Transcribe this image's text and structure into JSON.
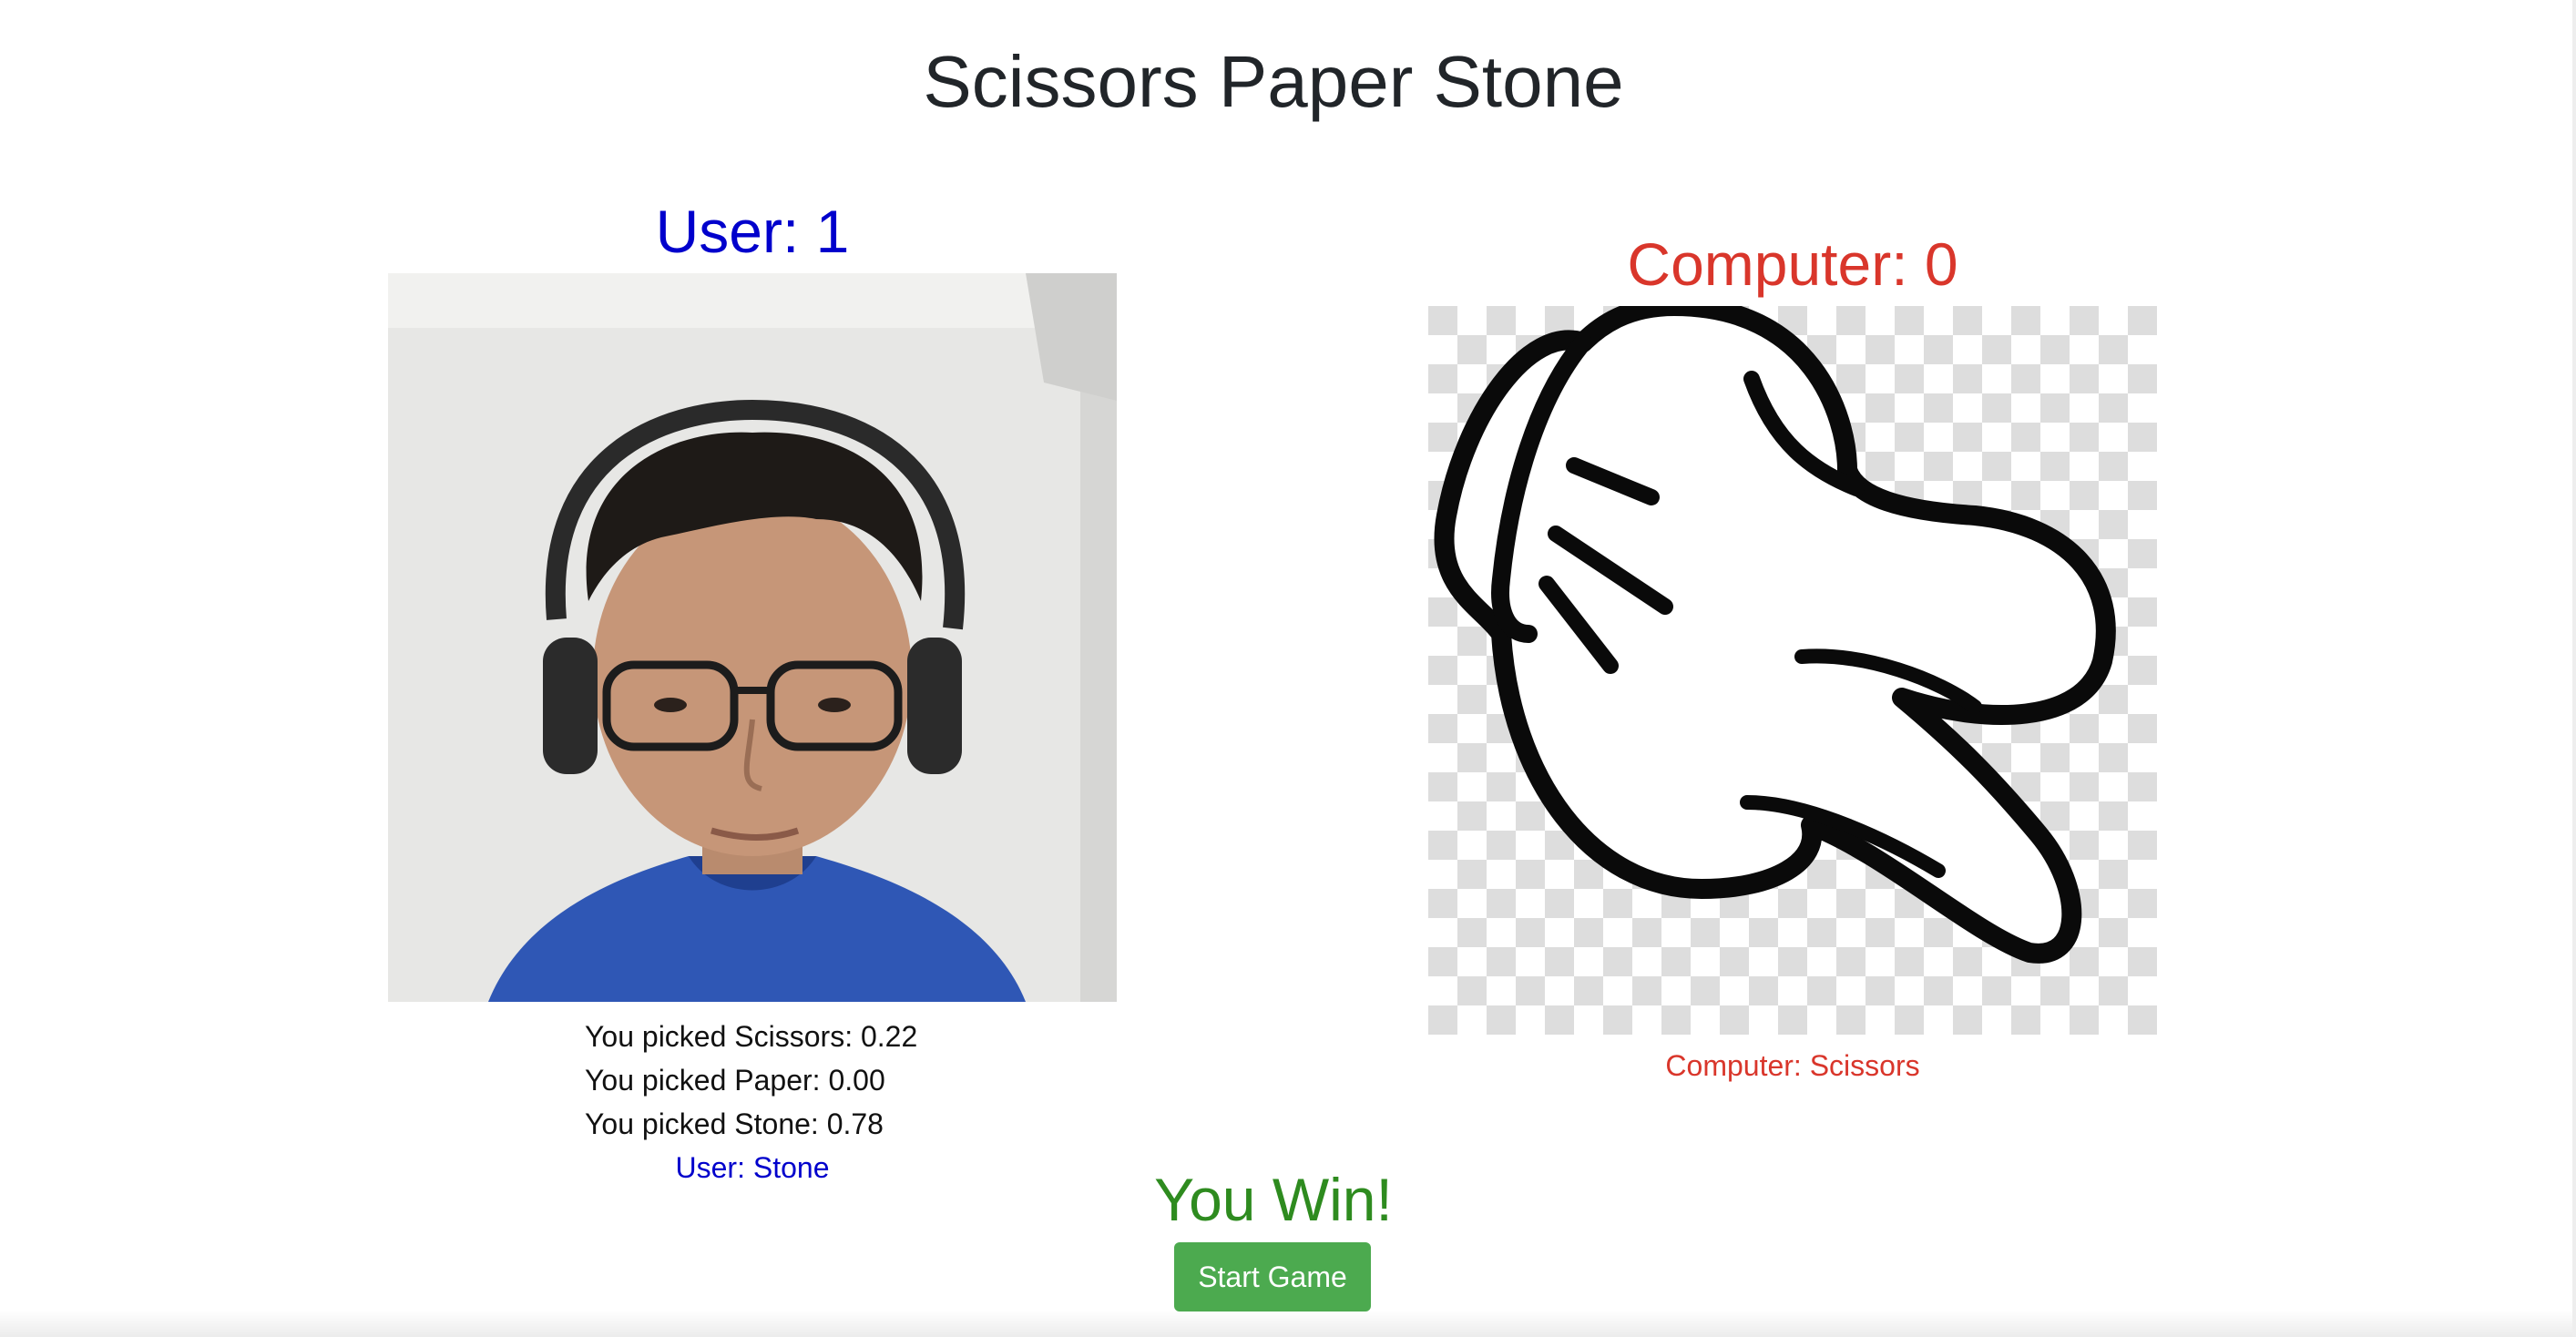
{
  "page": {
    "title": "Scissors Paper Stone"
  },
  "user": {
    "score_label": "User: 1",
    "probabilities": [
      "You picked Scissors: 0.22",
      "You picked Paper: 0.00",
      "You picked Stone: 0.78"
    ],
    "choice_label": "User: Stone"
  },
  "computer": {
    "score_label": "Computer: 0",
    "choice_label": "Computer: Scissors"
  },
  "result": {
    "text": "You Win!"
  },
  "controls": {
    "start_label": "Start Game"
  },
  "colors": {
    "user": "#0000cc",
    "computer": "#d9362b",
    "win": "#2e8b1f",
    "button": "#4caa4f"
  },
  "icons": {
    "computer_hand": "scissors-hand-icon"
  }
}
